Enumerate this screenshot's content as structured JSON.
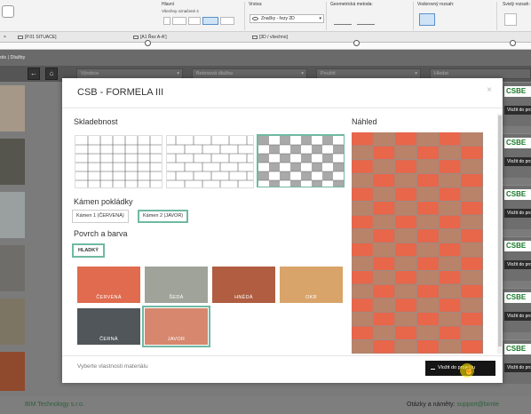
{
  "ribbon": {
    "sections": [
      {
        "label": "Hlavní",
        "sub": "Všechny označené 4"
      },
      {
        "label": "Vrstva:",
        "combo": "Značky - řezy 2D"
      },
      {
        "label": "Geometrická metoda:"
      },
      {
        "label": "Vodorovný rozsah:"
      },
      {
        "label": "Svislý rozsah:"
      }
    ]
  },
  "tabs": [
    {
      "label": "[P.01 SITUACE]"
    },
    {
      "label": "[A1 Řez A-A']"
    },
    {
      "label": "[3D / všechno]"
    }
  ],
  "path": "ols | Dlažby",
  "filters": [
    "Výrobce",
    "Betonová dlažba",
    "Použití",
    "Hledat"
  ],
  "modal": {
    "title": "CSB - FORMELA III",
    "close": "×",
    "skladebnost": "Skladebnost",
    "kamen_heading": "Kámen pokládky",
    "kamen_options": [
      "Kámen 1 (ČERVENÁ)",
      "Kámen 2 (JAVOR)"
    ],
    "povrch_heading": "Povrch a barva",
    "surface_button": "HLADKÝ",
    "swatches": [
      {
        "label": "ČERVENÁ",
        "color": "#e06b4f"
      },
      {
        "label": "ŠEDÁ",
        "color": "#a0a39a"
      },
      {
        "label": "HNĚDÁ",
        "color": "#b05d41"
      },
      {
        "label": "OKR",
        "color": "#d8a46a"
      },
      {
        "label": "ČERNÁ",
        "color": "#50565a"
      },
      {
        "label": "JAVOR",
        "color": "#d6876d"
      }
    ],
    "nahled": "Náhled",
    "hint": "Vyberte vlastnosti materiálu",
    "insert_button": "Vložit do projektu"
  },
  "product": {
    "logo": "CSBE",
    "insert": "Vložit do proj"
  },
  "footer": {
    "company": "BIM Technology s.r.o.",
    "questions": "Otázky a náměty:",
    "email": "support@bimte"
  },
  "colors": {
    "accent": "#6fb9a3",
    "preview_red": "#e8664a",
    "preview_brown": "#b9836a"
  }
}
